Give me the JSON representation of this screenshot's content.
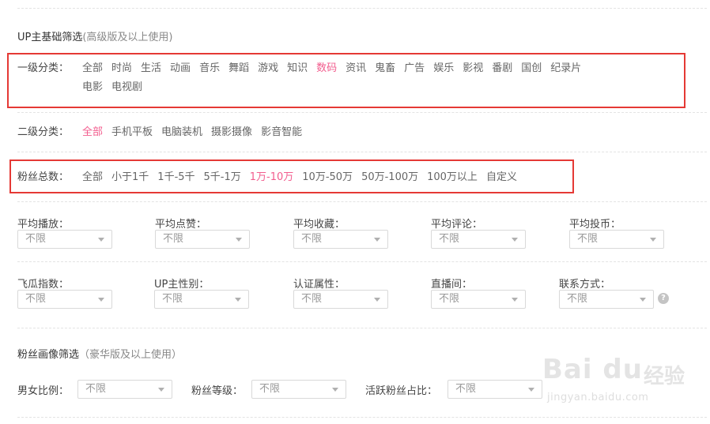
{
  "base_filter": {
    "title": "UP主基础筛选",
    "subtitle": "(高级版及以上使用)"
  },
  "level1": {
    "label": "一级分类：",
    "options": [
      "全部",
      "时尚",
      "生活",
      "动画",
      "音乐",
      "舞蹈",
      "游戏",
      "知识",
      "数码",
      "资讯",
      "鬼畜",
      "广告",
      "娱乐",
      "影视",
      "番剧",
      "国创",
      "纪录片"
    ],
    "options_row2": [
      "电影",
      "电视剧"
    ],
    "active": "数码"
  },
  "level2": {
    "label": "二级分类：",
    "options": [
      "全部",
      "手机平板",
      "电脑装机",
      "摄影摄像",
      "影音智能"
    ],
    "active": "全部"
  },
  "fans": {
    "label": "粉丝总数：",
    "options": [
      "全部",
      "小于1千",
      "1千-5千",
      "5千-1万",
      "1万-10万",
      "10万-50万",
      "50万-100万",
      "100万以上",
      "自定义"
    ],
    "active": "1万-10万"
  },
  "filters_row1": [
    {
      "label": "平均播放：",
      "value": "不限"
    },
    {
      "label": "平均点赞：",
      "value": "不限"
    },
    {
      "label": "平均收藏：",
      "value": "不限"
    },
    {
      "label": "平均评论：",
      "value": "不限"
    },
    {
      "label": "平均投币：",
      "value": "不限"
    }
  ],
  "filters_row2": [
    {
      "label": "飞瓜指数：",
      "value": "不限"
    },
    {
      "label": "UP主性别：",
      "value": "不限"
    },
    {
      "label": "认证属性：",
      "value": "不限"
    },
    {
      "label": "直播间：",
      "value": "不限"
    },
    {
      "label": "联系方式：",
      "value": "不限"
    }
  ],
  "help_glyph": "?",
  "fan_portrait": {
    "title": "粉丝画像筛选",
    "subtitle": "（豪华版及以上使用）",
    "filters": [
      {
        "label": "男女比例：",
        "value": "不限"
      },
      {
        "label": "粉丝等级：",
        "value": "不限"
      },
      {
        "label": "活跃粉丝占比：",
        "value": "不限"
      }
    ]
  },
  "watermark": {
    "brand": "Bai du",
    "cn": "经验",
    "url": "jingyan.baidu.com"
  },
  "colors": {
    "active": "#f25d8e",
    "highlight_box": "#e53935"
  }
}
